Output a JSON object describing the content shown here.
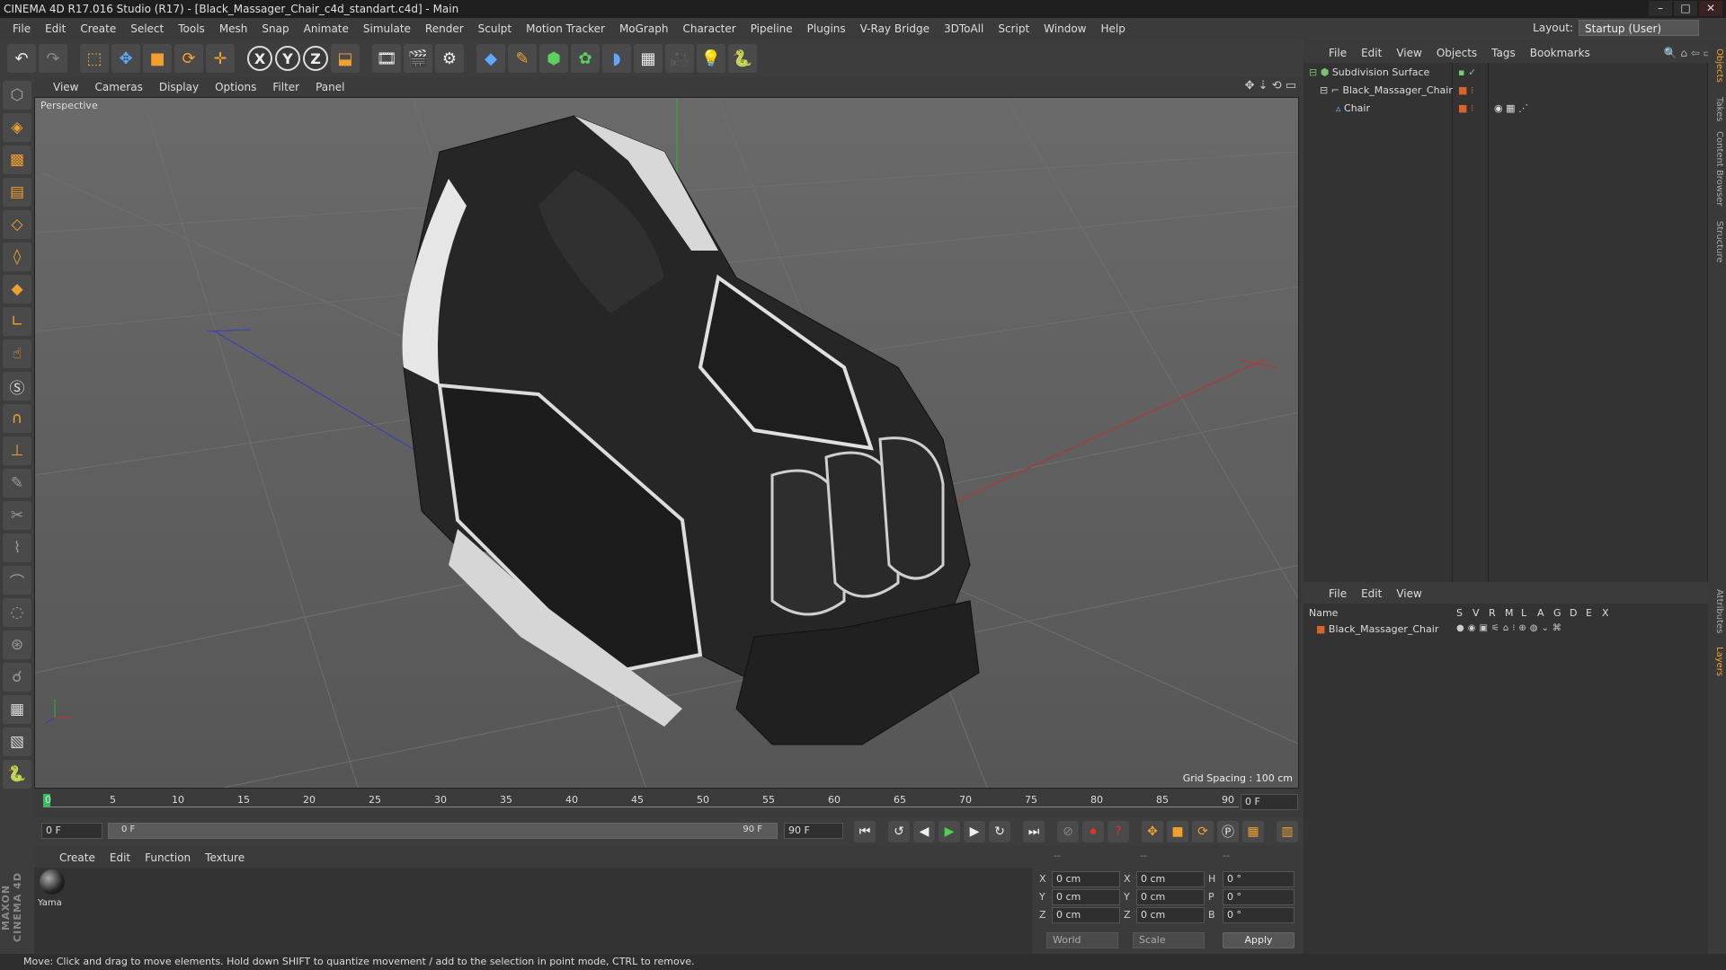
{
  "window": {
    "title": "CINEMA 4D R17.016 Studio (R17) - [Black_Massager_Chair_c4d_standart.c4d] - Main",
    "controls": [
      "–",
      "□",
      "✕"
    ]
  },
  "menubar": {
    "items": [
      "File",
      "Edit",
      "Create",
      "Select",
      "Tools",
      "Mesh",
      "Snap",
      "Animate",
      "Simulate",
      "Render",
      "Sculpt",
      "Motion Tracker",
      "MoGraph",
      "Character",
      "Pipeline",
      "Plugins",
      "V-Ray Bridge",
      "3DToAll",
      "Script",
      "Window",
      "Help"
    ],
    "layout_label": "Layout:",
    "layout_value": "Startup (User)"
  },
  "toolbar": {
    "axis_x": "X",
    "axis_y": "Y",
    "axis_z": "Z"
  },
  "viewport": {
    "menu": [
      "View",
      "Cameras",
      "Display",
      "Options",
      "Filter",
      "Panel"
    ],
    "label": "Perspective",
    "grid_spacing": "Grid Spacing : 100 cm"
  },
  "timeline": {
    "ticks": [
      "0",
      "5",
      "10",
      "15",
      "20",
      "25",
      "30",
      "35",
      "40",
      "45",
      "50",
      "55",
      "60",
      "65",
      "70",
      "75",
      "80",
      "85",
      "90"
    ],
    "frame_field": "0 F",
    "start_field": "0 F",
    "slider_start": "0 F",
    "slider_end": "90 F",
    "end_field": "90 F"
  },
  "material_manager": {
    "menu": [
      "Create",
      "Edit",
      "Function",
      "Texture"
    ],
    "material_name": "Yama"
  },
  "coordinates": {
    "header": [
      "--",
      "--",
      "--"
    ],
    "rows": [
      {
        "a": "X",
        "av": "0 cm",
        "b": "X",
        "bv": "0 cm",
        "c": "H",
        "cv": "0 °"
      },
      {
        "a": "Y",
        "av": "0 cm",
        "b": "Y",
        "bv": "0 cm",
        "c": "P",
        "cv": "0 °"
      },
      {
        "a": "Z",
        "av": "0 cm",
        "b": "Z",
        "bv": "0 cm",
        "c": "B",
        "cv": "0 °"
      }
    ],
    "world": "World",
    "scale": "Scale",
    "apply": "Apply"
  },
  "object_manager": {
    "menu": [
      "File",
      "Edit",
      "View",
      "Objects",
      "Tags",
      "Bookmarks"
    ],
    "objects": [
      {
        "name": "Subdivision Surface",
        "indent": 0
      },
      {
        "name": "Black_Massager_Chair",
        "indent": 1
      },
      {
        "name": "Chair",
        "indent": 2
      }
    ]
  },
  "layer_manager": {
    "menu": [
      "File",
      "Edit",
      "View"
    ],
    "col_name": "Name",
    "cols": [
      "S",
      "V",
      "R",
      "M",
      "L",
      "A",
      "G",
      "D",
      "E",
      "X"
    ],
    "layers": [
      {
        "name": "Black_Massager_Chair",
        "color": "#d8642a"
      }
    ]
  },
  "side_tabs": [
    "Objects",
    "Takes",
    "Content Browser",
    "Structure",
    "Attributes",
    "Layers"
  ],
  "brand": "MAXON CINEMA 4D",
  "status": "Move: Click and drag to move elements. Hold down SHIFT to quantize movement / add to the selection in point mode, CTRL to remove.",
  "colors": {
    "accent": "#f0a030",
    "layer": "#d8642a",
    "viewport_bg": "#5d5d5d"
  }
}
